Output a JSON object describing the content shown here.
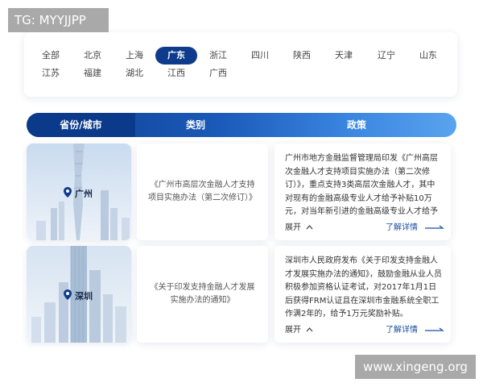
{
  "watermarks": {
    "top": "TG: MYYJJPP",
    "bottom": "www.xingeng.org"
  },
  "regions": {
    "row1": [
      "全部",
      "北京",
      "上海",
      "广东",
      "浙江",
      "四川",
      "陕西",
      "天津",
      "辽宁",
      "山东"
    ],
    "row2": [
      "江苏",
      "福建",
      "湖北",
      "江西",
      "广西"
    ],
    "selected": "广东"
  },
  "table_header": {
    "col1": "省份/城市",
    "col2": "类别",
    "col3": "政策"
  },
  "rows": [
    {
      "city": "广州",
      "category": "《广州市高层次金融人才支持项目实施办法（第二次修订）》",
      "policy": "广州市地方金融监督管理局印发《广州高层次金融人才支持项目实施办法（第二次修订）》，重点支持3类高层次金融人才，其中对现有的金融高级专业人才给予补贴10万元，对当年新引进的金融高级专业人才给予",
      "expand": "展开",
      "detail": "了解详情"
    },
    {
      "city": "深圳",
      "category": "《关于印发支持金融人才发展实施办法的通知》",
      "policy": "深圳市人民政府发布《关于印发支持金融人才发展实施办法的通知》，鼓励金融从业人员积极参加资格认证考试，对2017年1月1日后获得FRM认证且在深圳市金融系统全职工作满2年的，给予1万元奖励补贴。",
      "expand": "展开",
      "detail": "了解详情"
    }
  ],
  "colors": {
    "accent": "#0f3b8c",
    "link": "#1a4fa3"
  },
  "icons": {
    "pin": "map-pin-icon",
    "chevron": "chevron-up-icon",
    "arrow": "arrow-right-icon"
  }
}
